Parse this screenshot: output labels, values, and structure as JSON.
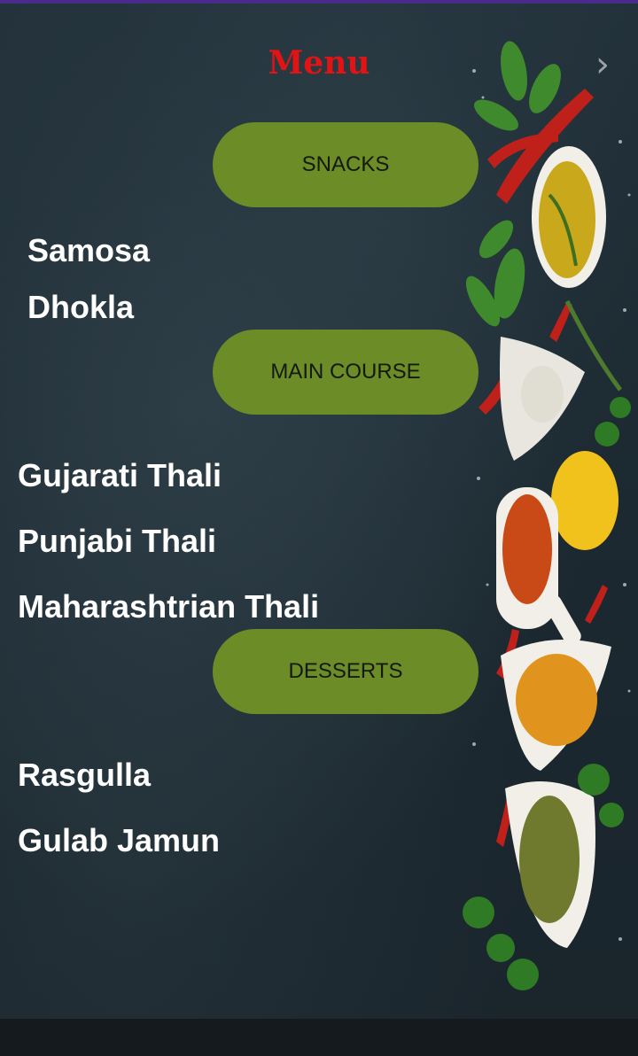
{
  "menu": {
    "title": "Menu",
    "sections": [
      {
        "label": "SNACKS",
        "items": [
          "Samosa",
          "Dhokla"
        ]
      },
      {
        "label": "MAIN COURSE",
        "items": [
          "Gujarati Thali",
          "Punjabi Thali",
          "Maharashtrian Thali"
        ]
      },
      {
        "label": "DESSERTS",
        "items": [
          "Rasgulla",
          "Gulab Jamun"
        ]
      }
    ]
  },
  "colors": {
    "title": "#e01414",
    "button_bg": "#6b8c26",
    "button_text": "#14190a",
    "item_text": "#ffffff",
    "background": "#1f2b33"
  },
  "icons": {
    "next": "chevron-right-icon",
    "decoration": "spices-image"
  }
}
